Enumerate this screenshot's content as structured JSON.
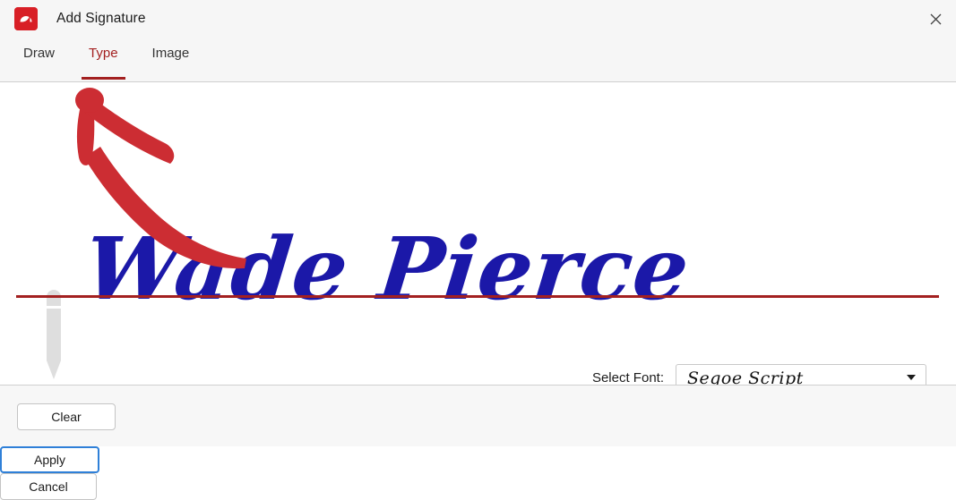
{
  "window": {
    "title": "Add Signature",
    "app_icon": "signature-app-icon",
    "close_icon": "close-icon"
  },
  "tabs": [
    {
      "label": "Draw",
      "active": false,
      "name": "tab-draw"
    },
    {
      "label": "Type",
      "active": true,
      "name": "tab-type"
    },
    {
      "label": "Image",
      "active": false,
      "name": "tab-image"
    }
  ],
  "canvas": {
    "signature_text": "Wade Pierce",
    "signature_color": "#1b18a8",
    "signature_line_color": "#a32020",
    "pencil_icon": "pencil-icon",
    "annotation_arrow_color": "#cc2d33"
  },
  "font_selector": {
    "label": "Select Font:",
    "selected": "Segoe Script",
    "caret_icon": "chevron-down-icon"
  },
  "footer": {
    "clear_label": "Clear",
    "apply_label": "Apply",
    "cancel_label": "Cancel"
  },
  "colors": {
    "accent_red": "#a32020",
    "brand_red": "#d81f26",
    "focus_blue": "#2f80d8",
    "ink_blue": "#1b18a8",
    "chrome_bg": "#f6f6f6"
  }
}
